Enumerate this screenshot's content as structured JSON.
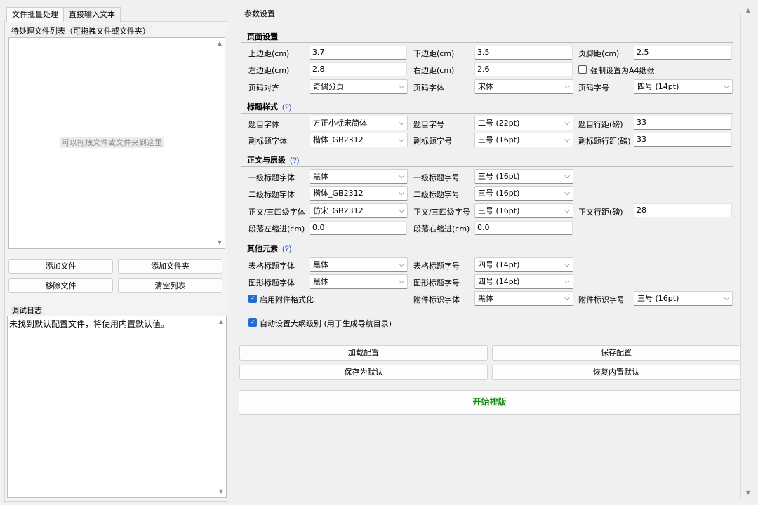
{
  "tabs": {
    "batch": "文件批量处理",
    "direct": "直接输入文本"
  },
  "file_list": {
    "title": "待处理文件列表（可拖拽文件或文件夹）",
    "placeholder": "可以拖拽文件或文件夹到这里",
    "add_file": "添加文件",
    "add_folder": "添加文件夹",
    "remove_file": "移除文件",
    "clear_list": "清空列表"
  },
  "log": {
    "title": "调试日志",
    "text": "未找到默认配置文件，将使用内置默认值。"
  },
  "params": {
    "title": "参数设置",
    "page": {
      "title": "页面设置",
      "top_margin_label": "上边距(cm)",
      "top_margin": "3.7",
      "bottom_margin_label": "下边距(cm)",
      "bottom_margin": "3.5",
      "footer_margin_label": "页脚距(cm)",
      "footer_margin": "2.5",
      "left_margin_label": "左边距(cm)",
      "left_margin": "2.8",
      "right_margin_label": "右边距(cm)",
      "right_margin": "2.6",
      "force_a4_label": "强制设置为A4纸张",
      "force_a4": false,
      "page_num_align_label": "页码对齐",
      "page_num_align": "奇偶分页",
      "page_num_font_label": "页码字体",
      "page_num_font": "宋体",
      "page_num_size_label": "页码字号",
      "page_num_size": "四号 (14pt)"
    },
    "heading": {
      "title": "标题样式",
      "help": "(?)",
      "title_font_label": "题目字体",
      "title_font": "方正小标宋简体",
      "title_size_label": "题目字号",
      "title_size": "二号 (22pt)",
      "title_spacing_label": "题目行距(磅)",
      "title_spacing": "33",
      "subtitle_font_label": "副标题字体",
      "subtitle_font": "楷体_GB2312",
      "subtitle_size_label": "副标题字号",
      "subtitle_size": "三号 (16pt)",
      "subtitle_spacing_label": "副标题行距(磅)",
      "subtitle_spacing": "33"
    },
    "body": {
      "title": "正文与层级",
      "help": "(?)",
      "h1_font_label": "一级标题字体",
      "h1_font": "黑体",
      "h1_size_label": "一级标题字号",
      "h1_size": "三号 (16pt)",
      "h2_font_label": "二级标题字体",
      "h2_font": "楷体_GB2312",
      "h2_size_label": "二级标题字号",
      "h2_size": "三号 (16pt)",
      "body_font_label": "正文/三四级字体",
      "body_font": "仿宋_GB2312",
      "body_size_label": "正文/三四级字号",
      "body_size": "三号 (16pt)",
      "body_spacing_label": "正文行距(磅)",
      "body_spacing": "28",
      "left_indent_label": "段落左缩进(cm)",
      "left_indent": "0.0",
      "right_indent_label": "段落右缩进(cm)",
      "right_indent": "0.0"
    },
    "other": {
      "title": "其他元素",
      "help": "(?)",
      "table_font_label": "表格标题字体",
      "table_font": "黑体",
      "table_size_label": "表格标题字号",
      "table_size": "四号 (14pt)",
      "figure_font_label": "图形标题字体",
      "figure_font": "黑体",
      "figure_size_label": "图形标题字号",
      "figure_size": "四号 (14pt)",
      "attach_format_label": "启用附件格式化",
      "attach_format": true,
      "attach_font_label": "附件标识字体",
      "attach_font": "黑体",
      "attach_size_label": "附件标识字号",
      "attach_size": "三号 (16pt)",
      "auto_outline_label": "自动设置大纲级别 (用于生成导航目录)",
      "auto_outline": true
    },
    "buttons": {
      "load": "加载配置",
      "save": "保存配置",
      "save_default": "保存为默认",
      "restore_default": "恢复内置默认",
      "start": "开始排版"
    }
  },
  "colors": {
    "accent": "#1f6fd1",
    "start_text": "#1a8b1a",
    "help": "#2a55c8"
  }
}
